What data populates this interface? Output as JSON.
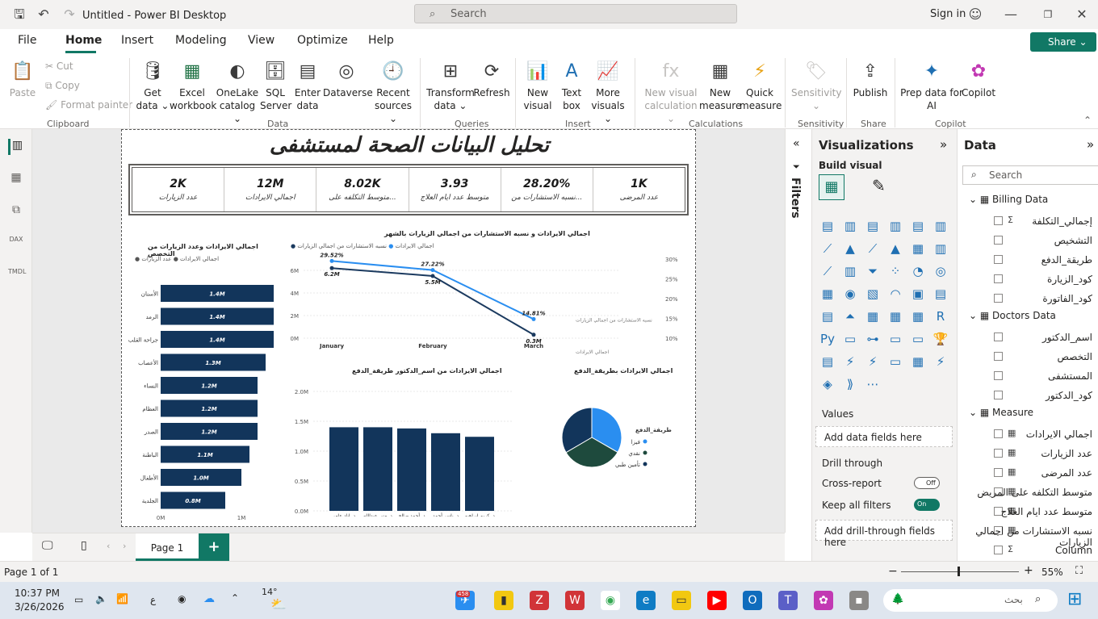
{
  "window": {
    "title": "Untitled - Power BI Desktop",
    "search_placeholder": "Search",
    "signin": "Sign in"
  },
  "menu": {
    "items": [
      "File",
      "Home",
      "Insert",
      "Modeling",
      "View",
      "Optimize",
      "Help"
    ],
    "share": "Share"
  },
  "ribbon": {
    "clipboard": {
      "paste": "Paste",
      "cut": "Cut",
      "copy": "Copy",
      "format_painter": "Format painter",
      "group": "Clipboard"
    },
    "data": {
      "get_data": [
        "Get",
        "data ⌄"
      ],
      "excel": [
        "Excel",
        "workbook"
      ],
      "onelake": [
        "OneLake",
        "catalog ⌄"
      ],
      "sql": [
        "SQL",
        "Server"
      ],
      "enter": [
        "Enter",
        "data"
      ],
      "dataverse": [
        "Dataverse",
        ""
      ],
      "recent": [
        "Recent",
        "sources ⌄"
      ],
      "group": "Data"
    },
    "queries": {
      "transform": [
        "Transform",
        "data ⌄"
      ],
      "refresh": [
        "Refresh",
        ""
      ],
      "group": "Queries"
    },
    "insert": {
      "new_visual": [
        "New",
        "visual"
      ],
      "text_box": [
        "Text",
        "box"
      ],
      "more_visuals": [
        "More",
        "visuals ⌄"
      ],
      "group": "Insert"
    },
    "calculations": {
      "new_visual_calc": [
        "New visual",
        "calculation ⌄"
      ],
      "new_measure": [
        "New",
        "measure"
      ],
      "quick_measure": [
        "Quick",
        "measure"
      ],
      "group": "Calculations"
    },
    "sensitivity": {
      "label": [
        "Sensitivity",
        "⌄"
      ],
      "group": "Sensitivity"
    },
    "share": {
      "publish": [
        "Publish",
        ""
      ],
      "group": "Share"
    },
    "copilot": {
      "prep": [
        "Prep data for",
        "AI"
      ],
      "copilot": [
        "Copilot",
        ""
      ],
      "group": "Copilot"
    }
  },
  "report": {
    "title": "تحليل البيانات الصحة لمستشفى",
    "kpis": [
      {
        "value": "2K",
        "label": "عدد الزيارات"
      },
      {
        "value": "12M",
        "label": "اجمالي الايرادات"
      },
      {
        "value": "8.02K",
        "label": "متوسط التكلفه على..."
      },
      {
        "value": "3.93",
        "label": "متوسط عدد ايام العلاج"
      },
      {
        "value": "28.20%",
        "label": "نسبه الاستشارات من..."
      },
      {
        "value": "1K",
        "label": "عدد المرضى"
      }
    ]
  },
  "chart_data": [
    {
      "type": "bar",
      "orientation": "horizontal",
      "title": "اجمالي الايرادات وعدد الزيارات من التخصص",
      "legend": [
        "اجمالي الايرادات",
        "عدد الزيارات"
      ],
      "categories": [
        "الأسنان",
        "الرمد",
        "جراحة القلب",
        "الأعصاب",
        "النساء",
        "العظام",
        "الصدر",
        "الباطنة",
        "الأطفال",
        "الجلدية"
      ],
      "values": [
        1.4,
        1.4,
        1.4,
        1.3,
        1.2,
        1.2,
        1.2,
        1.1,
        1.0,
        0.8
      ],
      "data_labels": [
        "1.4M",
        "1.4M",
        "1.4M",
        "1.3M",
        "1.2M",
        "1.2M",
        "1.2M",
        "1.1M",
        "1.0M",
        "0.8M"
      ],
      "x_ticks": [
        "0M",
        "1M"
      ],
      "xlim": [
        0,
        1.4
      ],
      "color": "#12355b"
    },
    {
      "type": "line",
      "title": "اجمالي الايرادات و نسبه الاستشارات من اجمالي الزيارات بالشهر",
      "categories": [
        "January",
        "February",
        "March"
      ],
      "series": [
        {
          "name": "نسبه الاستشارات من اجمالي الزيارات",
          "values": [
            29.52,
            27.22,
            14.81
          ],
          "labels": [
            "29.52%",
            "27.22%",
            "14.81%"
          ],
          "color": "#2a8ef0",
          "axis": "right"
        },
        {
          "name": "اجمالي الايرادات",
          "values": [
            6.2,
            5.5,
            0.3
          ],
          "labels": [
            "6.2M",
            "5.5M",
            "0.3M"
          ],
          "color": "#1b3a5f",
          "axis": "left"
        }
      ],
      "y_left_ticks": [
        "0M",
        "2M",
        "4M",
        "6M"
      ],
      "y_right_ticks": [
        "10%",
        "15%",
        "20%",
        "25%",
        "30%"
      ],
      "ylim_left": [
        0,
        7
      ],
      "ylim_right": [
        10,
        30
      ]
    },
    {
      "type": "bar",
      "title": "اجمالي الايرادات من اسم_الدكتور طريقة_الدفع",
      "categories": [
        "د. إياد عامر",
        "د. منى عبدالله",
        "د. أحمد صالح",
        "د. ياسر أحمد",
        "د. كريم ابراهيم"
      ],
      "values": [
        1.4,
        1.4,
        1.38,
        1.3,
        1.24
      ],
      "y_ticks": [
        "0.0M",
        "0.5M",
        "1.0M",
        "1.5M",
        "2.0M"
      ],
      "ylim": [
        0,
        2.0
      ],
      "color": "#12355b"
    },
    {
      "type": "pie",
      "title": "اجمالي الايرادات بطريقة_الدفع",
      "legend_title": "طريقة_الدفع",
      "labels": [
        "فيزا",
        "نقدي",
        "تأمين طبي"
      ],
      "values": [
        33.3,
        33.3,
        33.4
      ],
      "colors": [
        "#2a8ef0",
        "#1e4a3d",
        "#12355b"
      ]
    }
  ],
  "filters": {
    "label": "Filters"
  },
  "viz": {
    "title": "Visualizations",
    "build": "Build visual",
    "values": "Values",
    "add_fields": "Add data fields here",
    "drill": "Drill through",
    "cross_report": "Cross-report",
    "cross_state": "Off",
    "keep_filters": "Keep all filters",
    "keep_state": "On",
    "add_drill": "Add drill-through fields here"
  },
  "data_pane": {
    "title": "Data",
    "search_placeholder": "Search",
    "tables": [
      {
        "name": "Billing Data",
        "fields": [
          "إجمالي_التكلفة",
          "التشخيص",
          "طريقة_الدفع",
          "كود_الزيارة",
          "كود_الفاتورة"
        ]
      },
      {
        "name": "Doctors Data",
        "fields": [
          "اسم_الدكتور",
          "التخصص",
          "المستشفى",
          "كود_الدكتور"
        ]
      },
      {
        "name": "Measure",
        "fields": [
          "اجمالي الايرادات",
          "عدد الزيارات",
          "عدد المرضى",
          "متوسط التكلفه على المريض",
          "متوسط عدد ايام العلاج",
          "نسبه الاستشارات من اجمالي الزيارات",
          "Column"
        ]
      }
    ]
  },
  "pages": {
    "tab": "Page 1",
    "add": "+"
  },
  "status": {
    "page": "Page 1 of 1",
    "zoom": "55%"
  },
  "taskbar": {
    "time": "10:37 PM",
    "date": "3/26/2026",
    "weather": "14°",
    "search": "بحث",
    "badge": "458",
    "lang": "ع"
  }
}
